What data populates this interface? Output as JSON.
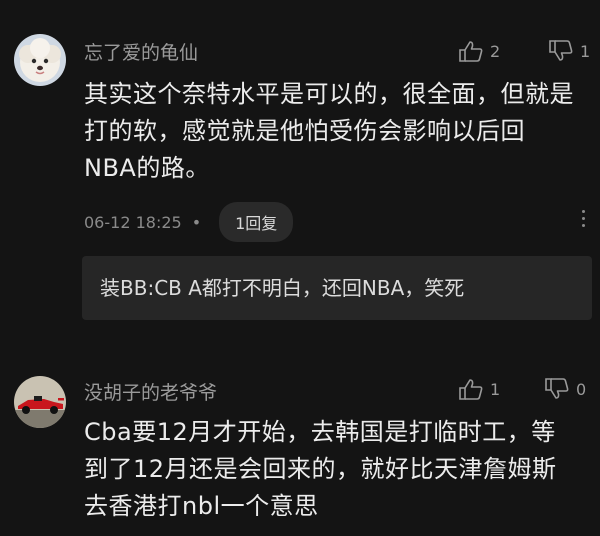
{
  "comments": [
    {
      "username": "忘了爱的龟仙",
      "like_count": "2",
      "dislike_count": "1",
      "lines": [
        "其实这个奈特水平是可以的，很全面，但就是",
        "打的软，感觉就是他怕受伤会影响以后回",
        "NBA的路。"
      ],
      "timestamp": "06-12 18:25",
      "separator": "•",
      "reply_count_label": "1回复",
      "sub_reply": {
        "author": "装BB",
        "colon": ":",
        "text": "CB A都打不明白，还回NBA，笑死"
      },
      "avatar_icon": "white-poodle-dog-avatar"
    },
    {
      "username": "没胡子的老爷爷",
      "like_count": "1",
      "dislike_count": "0",
      "lines": [
        "Cba要12月才开始，去韩国是打临时工，等",
        "到了12月还是会回来的，就好比天津詹姆斯",
        "去香港打nbl一个意思"
      ],
      "avatar_icon": "red-race-car-avatar"
    }
  ],
  "icons": {
    "like": "thumbs-up-icon",
    "dislike": "thumbs-down-icon",
    "more": "more-vertical-icon"
  },
  "colors": {
    "background": "#141414",
    "text": "#ececec",
    "muted": "#9a9a9a",
    "pill": "#2a2a2a",
    "reply_box": "#262626"
  }
}
